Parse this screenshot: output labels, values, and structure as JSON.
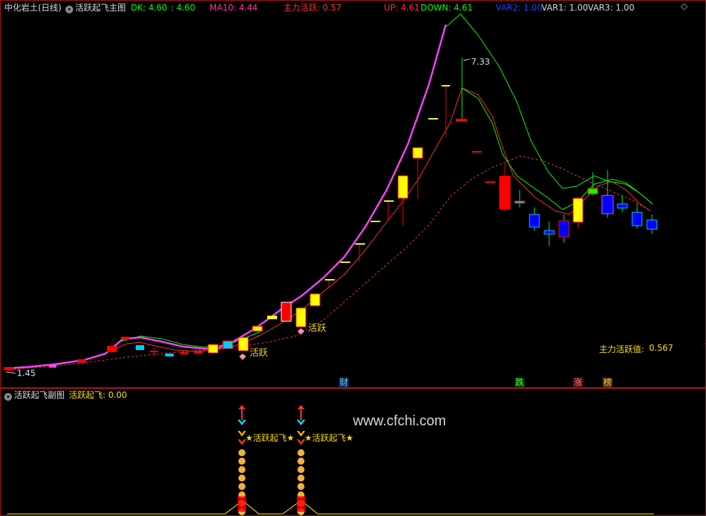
{
  "main": {
    "title": "中化岩土(日线)",
    "indicator_name": "活跃起飞主图",
    "dk_label": "DK: 4.60",
    "dk2_label": ": 4.60",
    "ma10_label": "MA10: 4.44",
    "zhuli_label": "主力活跃: 0.57",
    "up_label": "UP: 4.61",
    "down_label": "DOWN: 4.61",
    "var2_label": "VAR2: 1.00",
    "var1_label": "VAR1: 1.00",
    "var3_label": "VAR3: 1.00",
    "high_label": "7.33",
    "low_label": "1.45",
    "active_value_label": "主力活跃值:",
    "active_value": "0.567",
    "active_tag_1": "活跃",
    "active_tag_2": "活跃",
    "markers": {
      "cai": "财",
      "die": "跌",
      "zhang": "涨",
      "bang": "榜"
    },
    "colors": {
      "bg": "#000000",
      "up_candle": "#ffff00",
      "down_candle": "#0000ff",
      "red_candle": "#ff0000",
      "magenta": "#ff40ff",
      "green": "#00ff00",
      "red_line": "#ff3030",
      "gray_border": "#b0151b"
    }
  },
  "sub": {
    "indicator_name": "活跃起飞副图",
    "value_label": "活跃起飞: 0.00",
    "signal_text_1": "活跃起飞",
    "signal_text_2": "活跃起飞"
  },
  "watermark": "www.cfchi.com",
  "icons": {
    "collapse": "circle-chevron-icon",
    "diamond": "diamond-icon"
  }
}
